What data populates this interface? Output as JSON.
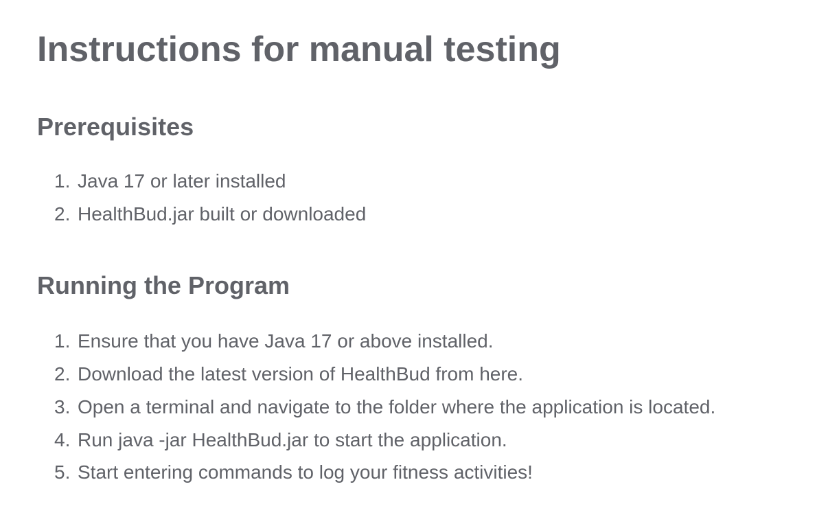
{
  "document": {
    "title": "Instructions for manual testing",
    "sections": [
      {
        "heading": "Prerequisites",
        "items": [
          {
            "num": "1.",
            "text": "Java 17 or later installed"
          },
          {
            "num": "2.",
            "text": "HealthBud.jar built or downloaded"
          }
        ]
      },
      {
        "heading": "Running the Program",
        "items": [
          {
            "num": "1.",
            "text": "Ensure that you have Java 17 or above installed."
          },
          {
            "num": "2.",
            "text": "Download the latest version of HealthBud from here."
          },
          {
            "num": "3.",
            "text": "Open a terminal and navigate to the folder where the application is located."
          },
          {
            "num": "4.",
            "text": "Run java -jar HealthBud.jar to start the application."
          },
          {
            "num": "5.",
            "text": "Start entering commands to log your fitness activities!"
          }
        ]
      }
    ]
  },
  "colors": {
    "text": "#606268",
    "background": "#ffffff"
  }
}
